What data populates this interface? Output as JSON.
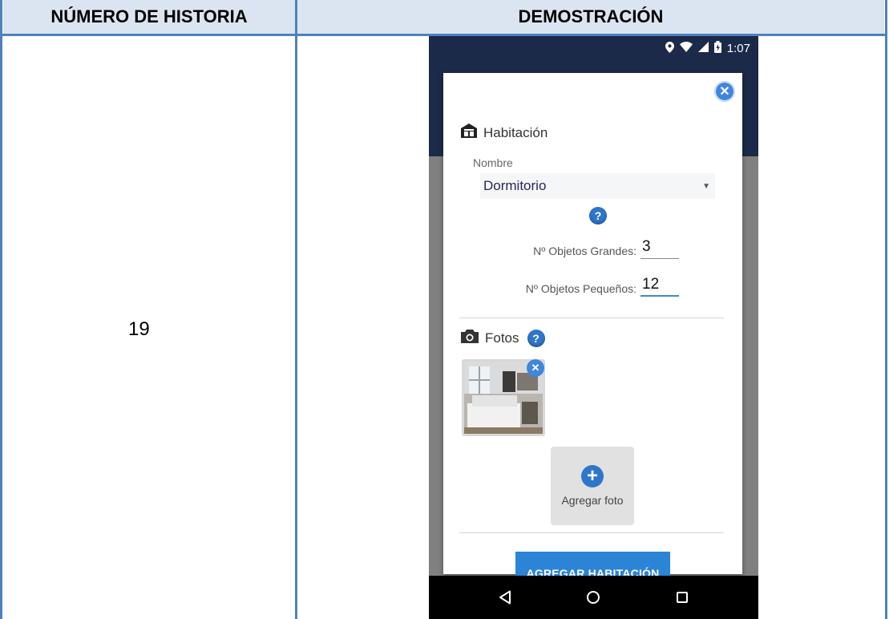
{
  "table": {
    "header_col1": "NÚMERO DE HISTORIA",
    "header_col2": "DEMOSTRACIÓN",
    "story_number": "19"
  },
  "phone": {
    "statusbar": {
      "time": "1:07",
      "icons": [
        "location-icon",
        "wifi-icon",
        "signal-icon",
        "battery-icon"
      ]
    },
    "dialog": {
      "title": "Habitación",
      "nombre_label": "Nombre",
      "nombre_value": "Dormitorio",
      "objetos_grandes_label": "Nº Objetos Grandes:",
      "objetos_grandes_value": "3",
      "objetos_pequenos_label": "Nº Objetos Pequeños:",
      "objetos_pequenos_value": "12",
      "fotos_title": "Fotos",
      "add_photo_label": "Agregar foto",
      "submit_label": "AGREGAR HABITACIÓN"
    },
    "navbar": [
      "back-icon",
      "home-icon",
      "recents-icon"
    ]
  },
  "colors": {
    "header_fill": "#dbe5f1",
    "table_border": "#4f81bd",
    "app_bar": "#1b2a48",
    "accent": "#2c84d6"
  }
}
